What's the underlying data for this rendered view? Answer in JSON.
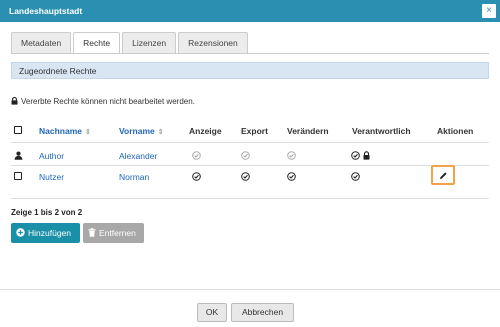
{
  "dialog": {
    "title": "Landeshauptstadt",
    "close_icon": "×"
  },
  "tabs": [
    {
      "label": "Metadaten",
      "active": false
    },
    {
      "label": "Rechte",
      "active": true
    },
    {
      "label": "Lizenzen",
      "active": false
    },
    {
      "label": "Rezensionen",
      "active": false
    }
  ],
  "section": {
    "title": "Zugeordnete Rechte"
  },
  "notice": {
    "text": "Vererbte Rechte können nicht bearbeitet werden.",
    "icon": "lock-icon"
  },
  "table": {
    "columns": [
      "Nachname",
      "Vorname",
      "Anzeige",
      "Export",
      "Verändern",
      "Verantwortlich",
      "Aktionen"
    ],
    "sort_icon": "⇕",
    "rows": [
      {
        "type": "inherited",
        "lead_icon": "user-icon",
        "nachname": "Author",
        "vorname": "Alexander",
        "anzeige": true,
        "export": true,
        "veraendern": true,
        "verantwortlich": true,
        "inherited_lock": true,
        "editable": false
      },
      {
        "type": "own",
        "lead_icon": "checkbox",
        "nachname": "Nutzer",
        "vorname": "Norman",
        "anzeige": true,
        "export": true,
        "veraendern": true,
        "verantwortlich": true,
        "inherited_lock": false,
        "editable": true
      }
    ],
    "summary": "Zeige 1 bis 2 von 2"
  },
  "actions": {
    "add_label": "Hinzufügen",
    "remove_label": "Entfernen"
  },
  "footer": {
    "ok_label": "OK",
    "cancel_label": "Abbrechen"
  },
  "colors": {
    "titlebar": "#2a8fb0",
    "link": "#1f65b8",
    "section_bg": "#d8e5f2",
    "add_button": "#1a8fa8",
    "remove_button": "#a8a8a8",
    "edit_highlight": "#f3a24a"
  }
}
